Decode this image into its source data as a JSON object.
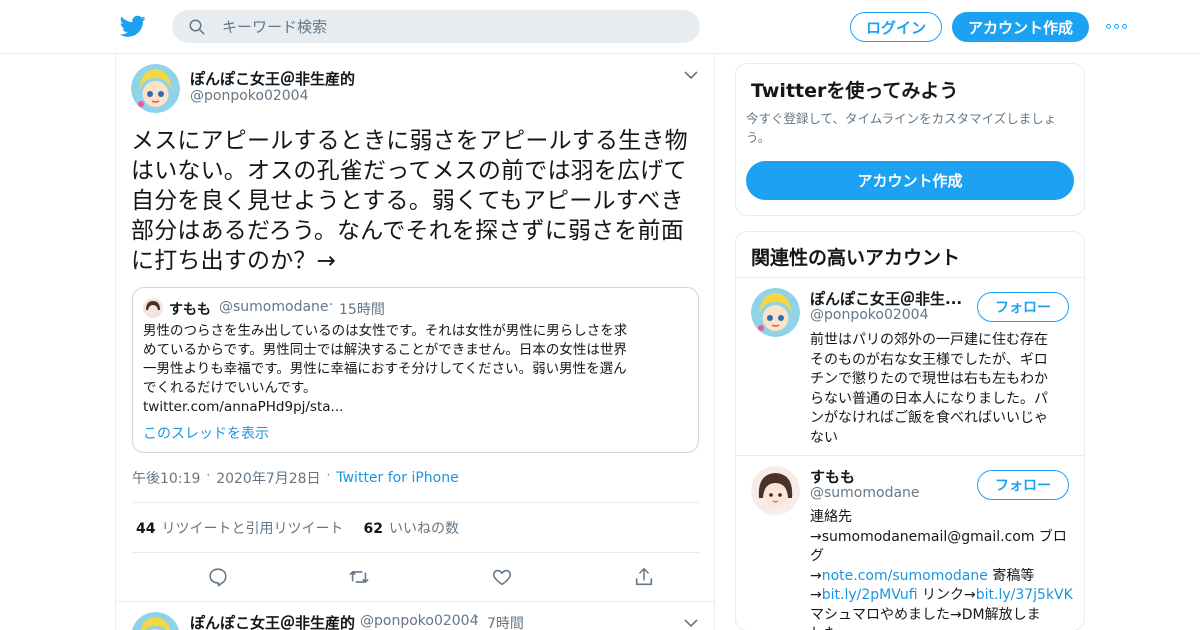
{
  "header": {
    "search_placeholder": "キーワード検索",
    "login_label": "ログイン",
    "signup_label": "アカウント作成"
  },
  "tweet": {
    "name": "ぽんぽこ女王＠非生産的",
    "handle": "@ponpoko02004",
    "text": "メスにアピールするときに弱さをアピールする生き物はいない。オスの孔雀だってメスの前では羽を広げて自分を良く見せようとする。弱くてもアピールすべき部分はあるだろう。なんでそれを探さずに弱さを前面に打ち出すのか？→",
    "quote": {
      "name": "すもも",
      "handle": "@sumomodane",
      "dot": "·",
      "time": "15時間",
      "text_lines": [
        "男性のつらさを生み出しているのは女性です。それは女性が男性に男らしさを求",
        "めているからです。男性同士では解決することができません。日本の女性は世界",
        "一男性よりも幸福です。男性に幸福におすそ分けしてください。弱い男性を選ん",
        "でくれるだけでいいんです。",
        "twitter.com/annaPHd9pj/sta..."
      ],
      "thread_link": "このスレッドを表示"
    },
    "time": "午後10:19",
    "sep": "·",
    "date": "2020年7月28日",
    "source": "Twitter for iPhone",
    "retweets_count": "44",
    "retweets_label": "リツイートと引用リツイート",
    "likes_count": "62",
    "likes_label": "いいねの数"
  },
  "next_tweet": {
    "name": "ぽんぽこ女王＠非生産的",
    "handle": "@ponpoko02004",
    "dot": "·",
    "time": "7時間"
  },
  "sidebar": {
    "try": {
      "title": "Twitterを使ってみよう",
      "desc": "今すぐ登録して、タイムラインをカスタマイズしましょう。",
      "button": "アカウント作成"
    },
    "related": {
      "title": "関連性の高いアカウント",
      "follow_label": "フォロー",
      "accounts": [
        {
          "name": "ぽんぽこ女王＠非生...",
          "handle": "@ponpoko02004",
          "bio_lines": [
            "前世はパリの郊外の一戸建に住む存在",
            "そのものが右な女王様でしたが、ギロ",
            "チンで懲りたので現世は右も左もわか",
            "らない普通の日本人になりました。パ",
            "ンがなければご飯を食べればいいじゃ",
            "ない"
          ]
        },
        {
          "name": "すもも",
          "handle": "@sumomodane",
          "bio": {
            "l1": "連絡先",
            "l2": "→sumomodanemail@gmail.com ブログ",
            "l3a": "→",
            "l3link": "note.com/sumomodane",
            "l3b": " 寄稿等",
            "l4a": "→",
            "l4link1": "bit.ly/2pMVufi",
            "l4b": " リンク→",
            "l4link2": "bit.ly/37j5kVK",
            "l5": "マシュマロやめました→DM解放しま",
            "l6": "した"
          }
        }
      ]
    }
  },
  "colors": {
    "accent": "#1da1f2",
    "link": "#1b95e0",
    "secondary_text": "#657786",
    "border": "#e6ecf0"
  }
}
